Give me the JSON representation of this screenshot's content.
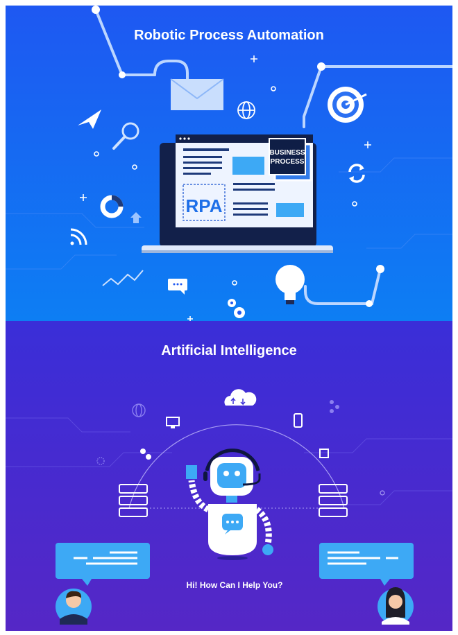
{
  "rpa": {
    "title": "Robotic Process Automation",
    "screen_badge": "RPA",
    "business_process_line1": "BUSINESS",
    "business_process_line2": "PROCESS",
    "colors": {
      "bg_top": "#1a5cf0",
      "bg_bottom": "#0a8bf5",
      "accent": "#3da9f5"
    },
    "icons": [
      "envelope-icon",
      "paper-plane-icon",
      "magnifier-icon",
      "globe-icon",
      "target-icon",
      "refresh-icon",
      "pie-chart-icon",
      "up-arrow-icon",
      "wifi-icon",
      "line-graph-icon",
      "chat-bubble-icon",
      "gears-icon",
      "lightbulb-icon",
      "laptop-icon"
    ]
  },
  "ai": {
    "title": "Artificial Intelligence",
    "speech": "Hi! How Can I Help You?",
    "colors": {
      "bg_top": "#3b2bd6",
      "bg_bottom": "#5a28c8",
      "accent": "#3da9f5"
    },
    "icons": [
      "cloud-icon",
      "monitor-icon",
      "phone-icon",
      "gears-icon",
      "chip-icon",
      "server-icon",
      "robot-icon",
      "user-avatar-icon",
      "globe-icon"
    ]
  }
}
